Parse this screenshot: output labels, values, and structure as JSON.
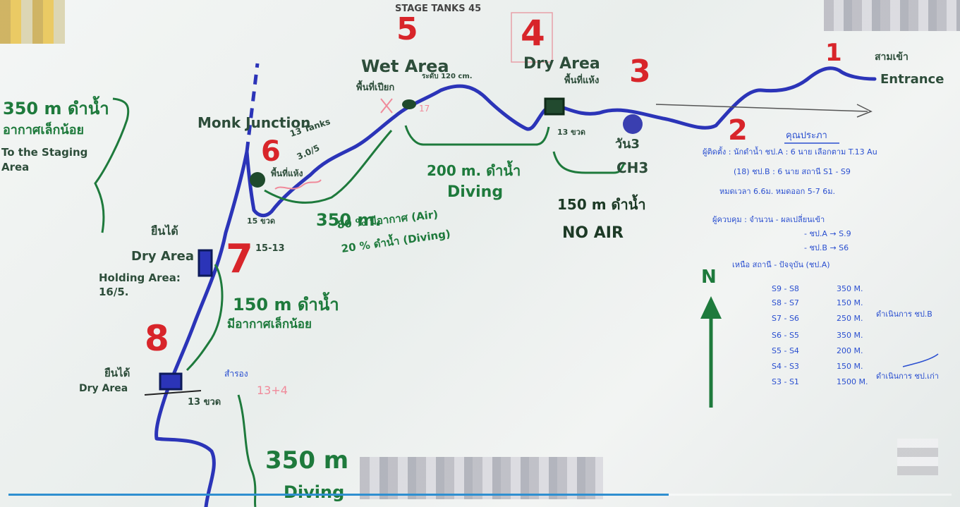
{
  "top": {
    "stage_tanks": "STAGE TANKS 45"
  },
  "chambers": {
    "c1": "1",
    "c2": "2",
    "c3": "3",
    "c4": "4",
    "c5": "5",
    "c6": "6",
    "c7": "7",
    "c8": "8"
  },
  "places": {
    "entrance": "Entrance",
    "entrance_thai": "สามเข้า",
    "dry_area_top": "Dry Area",
    "dry_area_top_thai": "พื้นที่แห้ง",
    "wet_area": "Wet Area",
    "wet_area_thai": "พื้นที่เปียก",
    "wet_area_depth": "ระดับ 120 cm.",
    "monk_junction": "Monk Junction",
    "ch3_top": "วัน3",
    "ch3_bottom": "CH3",
    "left_dry_area": "Dry Area",
    "left_dry_thai": "ยืนได้",
    "holding_area": "Holding Area: 16/5.",
    "bottom_dry_area": "Dry Area",
    "bottom_dry_thai": "ยืนได้",
    "c6_thai": "พื้นที่แห้ง",
    "c6_tanks": "13 Tanks",
    "c6_extra": "3.0/5"
  },
  "distances": {
    "d200": "200 m. ดำน้ำ",
    "d200_diving": "Diving",
    "d150_top": "150 m ดำน้ำ",
    "d150_noair": "NO AIR",
    "d350_mid": "350 m.",
    "d350_air": "80 % มีอากาศ (Air)",
    "d350_diving": "20 % ดำน้ำ (Diving)",
    "d150_left": "150 m ดำน้ำ",
    "d150_left_thai": "มีอากาศเล็กน้อย",
    "d350_bottom": "350 m",
    "d350_bottom_diving": "Diving",
    "staging_distance": "350 m ดำน้ำ",
    "staging_thai": "อากาศเล็กน้อย",
    "staging_en": "To the Staging Area"
  },
  "marks": {
    "m13_ch4": "13 ขวด",
    "m15_ch6": "15 ขวด",
    "m15_13": "15-13",
    "m13_ch8": "13 ขวด",
    "m13_4": "13+4",
    "m_pink_label": "สำรอง",
    "m17": "17"
  },
  "legend": {
    "heading": "คุณประภา",
    "lines": [
      "ผู้ติดตั้ง : นักดำน้ำ ชป.A : 6 นาย เลือกตาม T.13 Au",
      "(18)  ชป.B : 6 นาย สถานี S1 - S9",
      "หมดเวลา 6.6ม. หมดออก 5-7 6ม.",
      "ผู้ควบคุม : จำนวน - ผลเปลี่ยนเข้า",
      "- ชป.A → S.9",
      "- ชป.B → S6",
      "เหนือ สถานี - ปัจจุบัน (ชป.A)"
    ],
    "stations": [
      {
        "range": "S9 - S8",
        "dist": "350 M.",
        "note": ""
      },
      {
        "range": "S8 - S7",
        "dist": "150 M.",
        "note": ""
      },
      {
        "range": "S7 - S6",
        "dist": "250 M.",
        "note": "ดำเนินการ ชป.B"
      },
      {
        "range": "S6 - S5",
        "dist": "350 M.",
        "note": ""
      },
      {
        "range": "S5 - S4",
        "dist": "200 M.",
        "note": ""
      },
      {
        "range": "S4 - S3",
        "dist": "150 M.",
        "note": ""
      },
      {
        "range": "S3 - S1",
        "dist": "1500 M.",
        "note": "ดำเนินการ ชป.เก่า"
      }
    ],
    "north": "N"
  },
  "video": {
    "progress": 0.7
  },
  "colors": {
    "route": "#2b34b8",
    "ink_green": "#1e7a3c",
    "ink_red": "#d8252a",
    "ink_blue": "#2a4fd0"
  }
}
